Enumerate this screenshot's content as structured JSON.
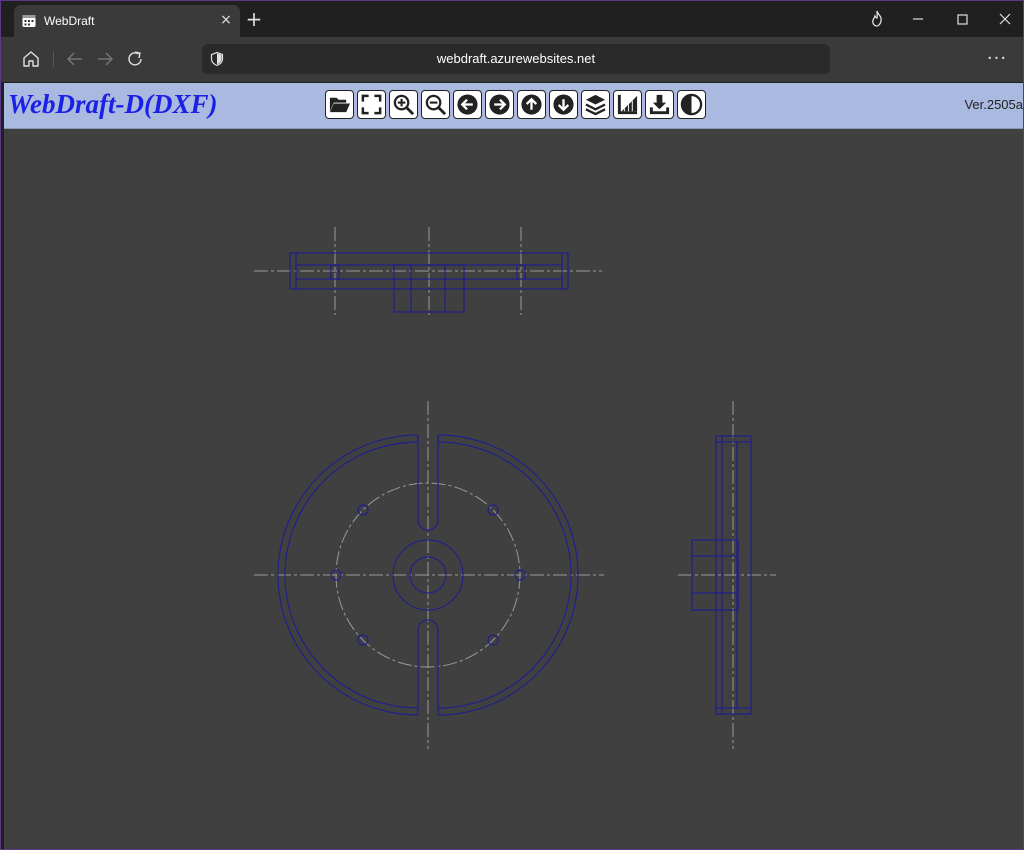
{
  "browser": {
    "tab_title": "WebDraft",
    "tab_icon": "calendar-app-icon",
    "tab_close": "×",
    "new_tab": "+",
    "url": "webdraft.azurewebsites.net",
    "more_menu": "···"
  },
  "app": {
    "title": "WebDraft-D(DXF)",
    "version": "Ver.2505a",
    "title_color": "#1b20e6",
    "header_color": "#aab9e0",
    "canvas_color": "#404040",
    "line_color": "#20208a",
    "centerline_color": "#9a9a9a",
    "tools": [
      {
        "name": "open-file",
        "icon": "folder-open-icon"
      },
      {
        "name": "fit-view",
        "icon": "fullscreen-icon"
      },
      {
        "name": "zoom-in",
        "icon": "zoom-in-icon"
      },
      {
        "name": "zoom-out",
        "icon": "zoom-out-icon"
      },
      {
        "name": "pan-left",
        "icon": "arrow-left-icon"
      },
      {
        "name": "pan-right",
        "icon": "arrow-right-icon"
      },
      {
        "name": "pan-up",
        "icon": "arrow-up-icon"
      },
      {
        "name": "pan-down",
        "icon": "arrow-down-icon"
      },
      {
        "name": "layers",
        "icon": "layers-icon"
      },
      {
        "name": "measure",
        "icon": "ruler-icon"
      },
      {
        "name": "download",
        "icon": "download-icon"
      },
      {
        "name": "contrast",
        "icon": "contrast-icon"
      }
    ]
  }
}
